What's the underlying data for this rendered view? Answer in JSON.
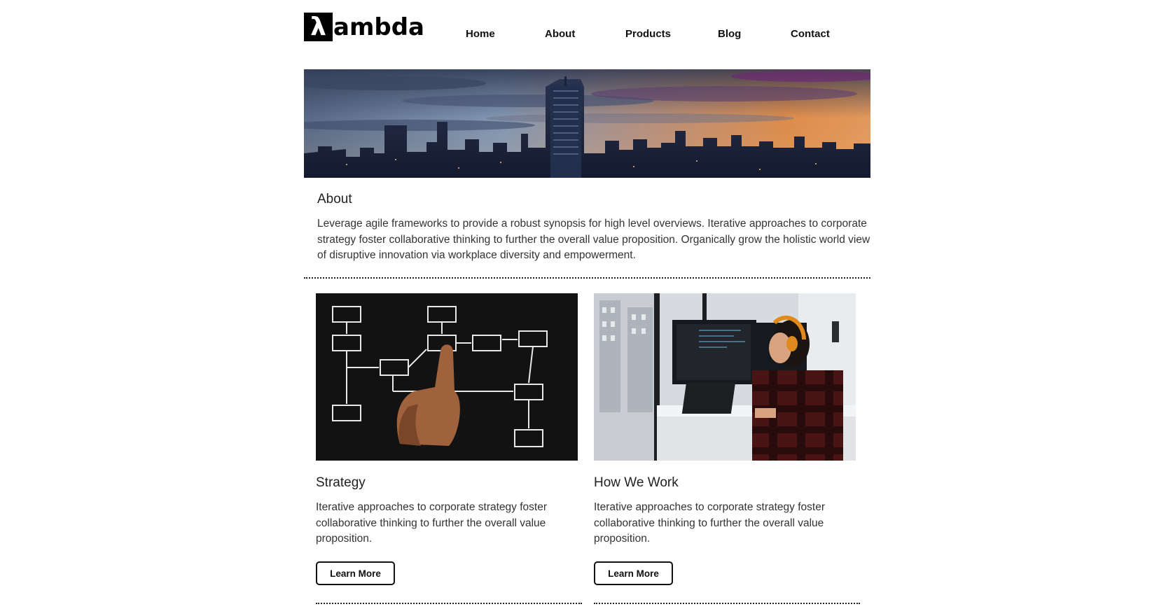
{
  "brand": {
    "logo_mark": "λ",
    "logo_text": "ambda"
  },
  "nav": {
    "items": [
      {
        "label": "Home"
      },
      {
        "label": "About"
      },
      {
        "label": "Products"
      },
      {
        "label": "Blog"
      },
      {
        "label": "Contact"
      }
    ]
  },
  "about": {
    "title": "About",
    "body": "Leverage agile frameworks to provide a robust synopsis for high level overviews. Iterative approaches to corporate strategy foster collaborative thinking to further the overall value proposition. Organically grow the holistic world view of disruptive innovation via workplace diversity and empowerment."
  },
  "cards": [
    {
      "title": "Strategy",
      "body": "Iterative approaches to corporate strategy foster collaborative thinking to further the overall value proposition.",
      "button_label": "Learn More"
    },
    {
      "title": "How We Work",
      "body": "Iterative approaches to corporate strategy foster collaborative thinking to further the overall value proposition.",
      "button_label": "Learn More"
    }
  ],
  "colors": {
    "text": "#222222",
    "background": "#ffffff",
    "accent": "#000000"
  }
}
